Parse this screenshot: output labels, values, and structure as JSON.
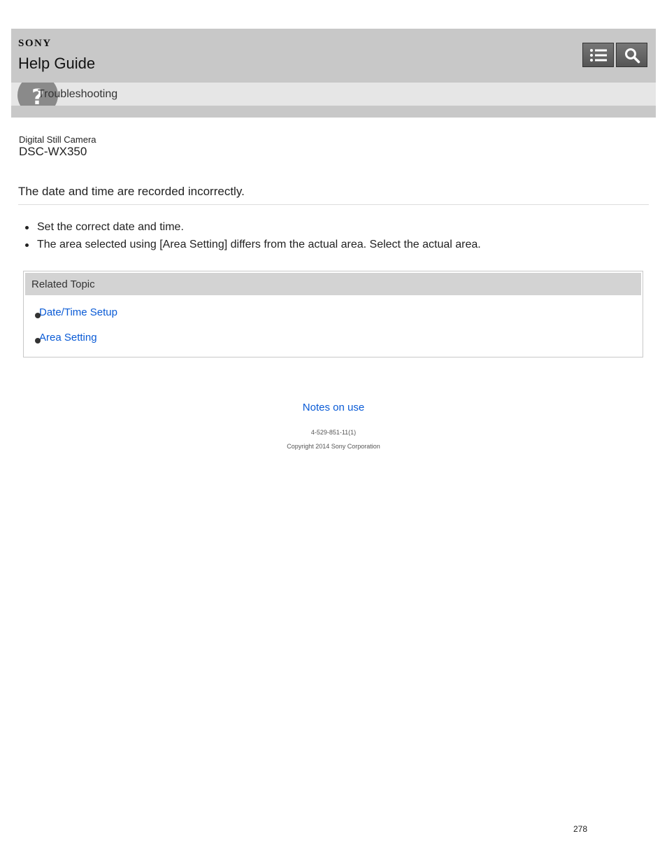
{
  "header": {
    "brand": "SONY",
    "title": "Help Guide",
    "toc_icon": "list-icon",
    "search_icon": "search-icon"
  },
  "category": {
    "icon": "question-icon",
    "label": "Troubleshooting"
  },
  "product": {
    "type": "Digital Still Camera",
    "model": "DSC-WX350"
  },
  "topic": {
    "title": "The date and time are recorded incorrectly.",
    "bullets": [
      "Set the correct date and time.",
      "The area selected using [Area Setting] differs from the actual area. Select the actual area."
    ]
  },
  "related": {
    "heading": "Related Topic",
    "links": [
      "Date/Time Setup",
      "Area Setting"
    ]
  },
  "footer": {
    "notes_link": "Notes on use",
    "doc_id": "4-529-851-11(1)",
    "copyright": "Copyright 2014 Sony Corporation",
    "page_number": "278"
  },
  "colors": {
    "header_bg": "#c8c8c8",
    "category_bg": "#e6e6e6",
    "link": "#0a5bd6"
  }
}
